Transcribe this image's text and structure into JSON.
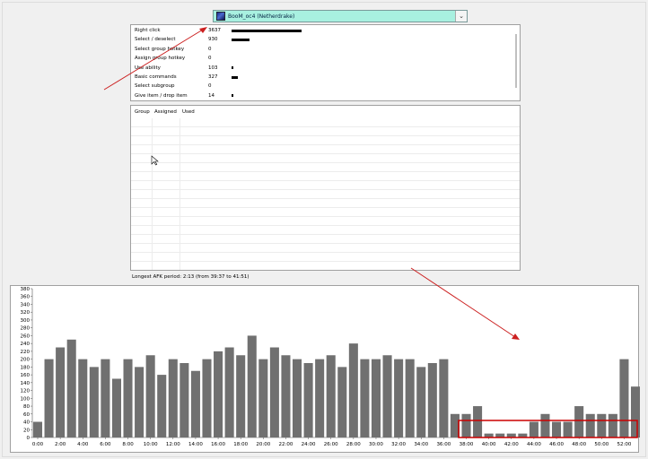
{
  "player_select": {
    "label": "BooM_oc4 (Netherdrake)",
    "icon": "netherdrake-race-icon"
  },
  "actions": [
    {
      "name": "Right click",
      "count": 3637,
      "bar_fraction": 1.0
    },
    {
      "name": "Select / deselect",
      "count": 930,
      "bar_fraction": 0.256
    },
    {
      "name": "Select group hotkey",
      "count": 0,
      "bar_fraction": 0.0
    },
    {
      "name": "Assign group hotkey",
      "count": 0,
      "bar_fraction": 0.0
    },
    {
      "name": "Use ability",
      "count": 103,
      "bar_fraction": 0.03
    },
    {
      "name": "Basic commands",
      "count": 327,
      "bar_fraction": 0.09
    },
    {
      "name": "Select subgroup",
      "count": 0,
      "bar_fraction": 0.0
    },
    {
      "name": "Give item / drop item",
      "count": 14,
      "bar_fraction": 0.0
    }
  ],
  "groups_table": {
    "headers": [
      "Group",
      "Assigned",
      "Used"
    ]
  },
  "afk_text": "Longest AFK period: 2:13 (from 39:37 to 41:51)",
  "chart_data": {
    "type": "bar",
    "title": "",
    "xlabel": "",
    "ylabel": "",
    "ylim": [
      0,
      380
    ],
    "yticks": [
      0,
      20,
      40,
      60,
      80,
      100,
      120,
      140,
      160,
      180,
      200,
      220,
      240,
      260,
      280,
      300,
      320,
      340,
      360,
      380
    ],
    "xlim_minutes": [
      0,
      53
    ],
    "xtick_labels": [
      "0:00",
      "2:00",
      "4:00",
      "6:00",
      "8:00",
      "10:00",
      "12:00",
      "14:00",
      "16:00",
      "18:00",
      "20:00",
      "22:00",
      "24:00",
      "26:00",
      "28:00",
      "30:00",
      "32:00",
      "34:00",
      "36:00",
      "38:00",
      "40:00",
      "42:00",
      "44:00",
      "46:00",
      "48:00",
      "50:00",
      "52:00"
    ],
    "bar_color": "#707070",
    "x_minutes": [
      0,
      1,
      2,
      3,
      4,
      5,
      6,
      7,
      8,
      9,
      10,
      11,
      12,
      13,
      14,
      15,
      16,
      17,
      18,
      19,
      20,
      21,
      22,
      23,
      24,
      25,
      26,
      27,
      28,
      29,
      30,
      31,
      32,
      33,
      34,
      35,
      36,
      37,
      38,
      39,
      40,
      41,
      42,
      43,
      44,
      45,
      46,
      47,
      48,
      49,
      50,
      51,
      52,
      53
    ],
    "values": [
      40,
      200,
      230,
      250,
      200,
      180,
      200,
      150,
      200,
      180,
      210,
      160,
      200,
      190,
      170,
      200,
      220,
      230,
      210,
      260,
      200,
      230,
      210,
      200,
      190,
      200,
      210,
      180,
      240,
      200,
      200,
      210,
      200,
      200,
      180,
      190,
      200,
      60,
      60,
      80,
      10,
      10,
      10,
      10,
      40,
      60,
      40,
      40,
      80,
      60,
      60,
      60,
      200,
      130
    ]
  },
  "annotations": {
    "arrow_color": "#cc2020",
    "box_color": "#cc0000"
  }
}
